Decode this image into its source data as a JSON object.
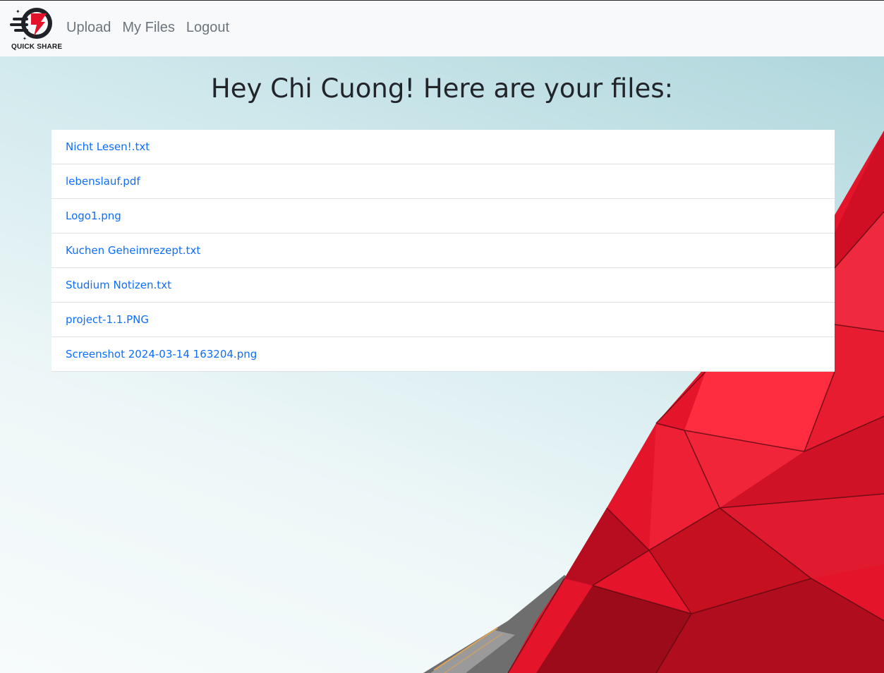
{
  "brand": {
    "name": "QUICK SHARE",
    "icon": "lightning-logo-icon"
  },
  "nav": {
    "items": [
      {
        "label": "Upload"
      },
      {
        "label": "My Files"
      },
      {
        "label": "Logout"
      }
    ]
  },
  "main": {
    "heading": "Hey Chi Cuong! Here are your files:",
    "files": [
      {
        "name": "Nicht Lesen!.txt"
      },
      {
        "name": "lebenslauf.pdf"
      },
      {
        "name": "Logo1.png"
      },
      {
        "name": "Kuchen Geheimrezept.txt"
      },
      {
        "name": "Studium Notizen.txt"
      },
      {
        "name": "project-1.1.PNG"
      },
      {
        "name": "Screenshot 2024-03-14 163204.png"
      }
    ]
  },
  "colors": {
    "navbar_bg": "#f8f9fa",
    "nav_link": "#6c757d",
    "file_link": "#0d6efd",
    "heading": "#212529",
    "building_red": "#e3132c"
  }
}
